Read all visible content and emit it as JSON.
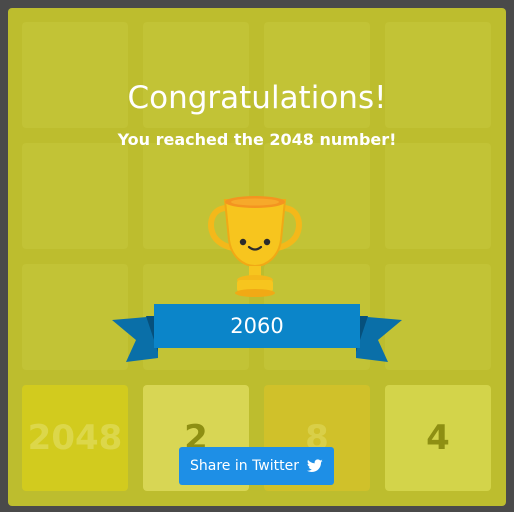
{
  "game": {
    "tiles_bottom_row": [
      "2048",
      "2",
      "8",
      "4"
    ]
  },
  "overlay": {
    "title": "Congratulations!",
    "subtitle": "You reached the 2048 number!",
    "score": "2060",
    "share_label": "Share in Twitter"
  },
  "icons": {
    "trophy": "trophy-icon",
    "twitter": "twitter-icon"
  },
  "colors": {
    "board": "#bdbd2e",
    "empty_cell": "#c2c336",
    "ribbon": "#0b85c9",
    "share_button": "#1e8fe6",
    "trophy": "#f7c51e"
  }
}
